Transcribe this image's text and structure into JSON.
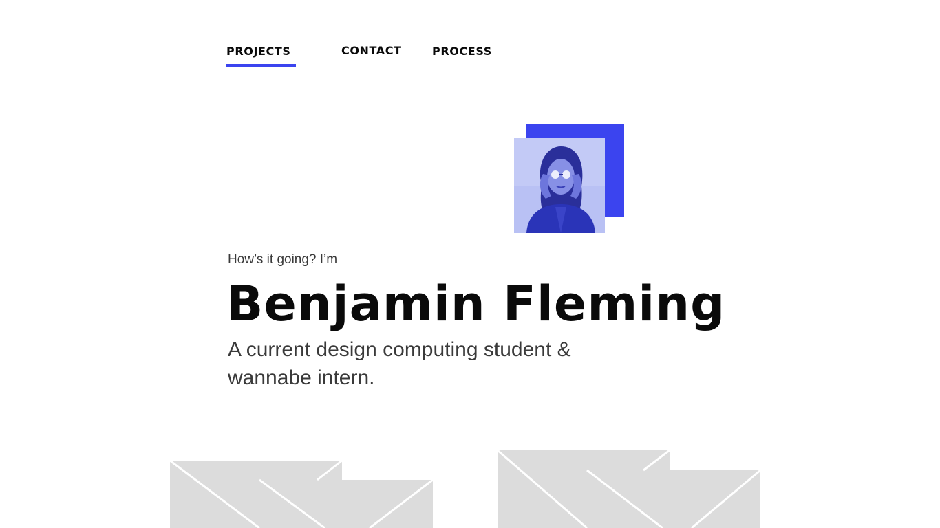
{
  "nav": {
    "items": [
      {
        "label": "PROJECTS",
        "active": true
      },
      {
        "label": "CONTACT",
        "active": false
      },
      {
        "label": "PROCESS",
        "active": false
      }
    ],
    "accent_color": "#3b44ef"
  },
  "hero": {
    "greeting": "How’s it going? I’m",
    "name": "Benjamin Fleming",
    "tagline": "A current design computing student & wannabe intern."
  },
  "projects": {
    "thumbnails": [
      {
        "placeholder": "image-placeholder"
      },
      {
        "placeholder": "image-placeholder"
      }
    ]
  }
}
